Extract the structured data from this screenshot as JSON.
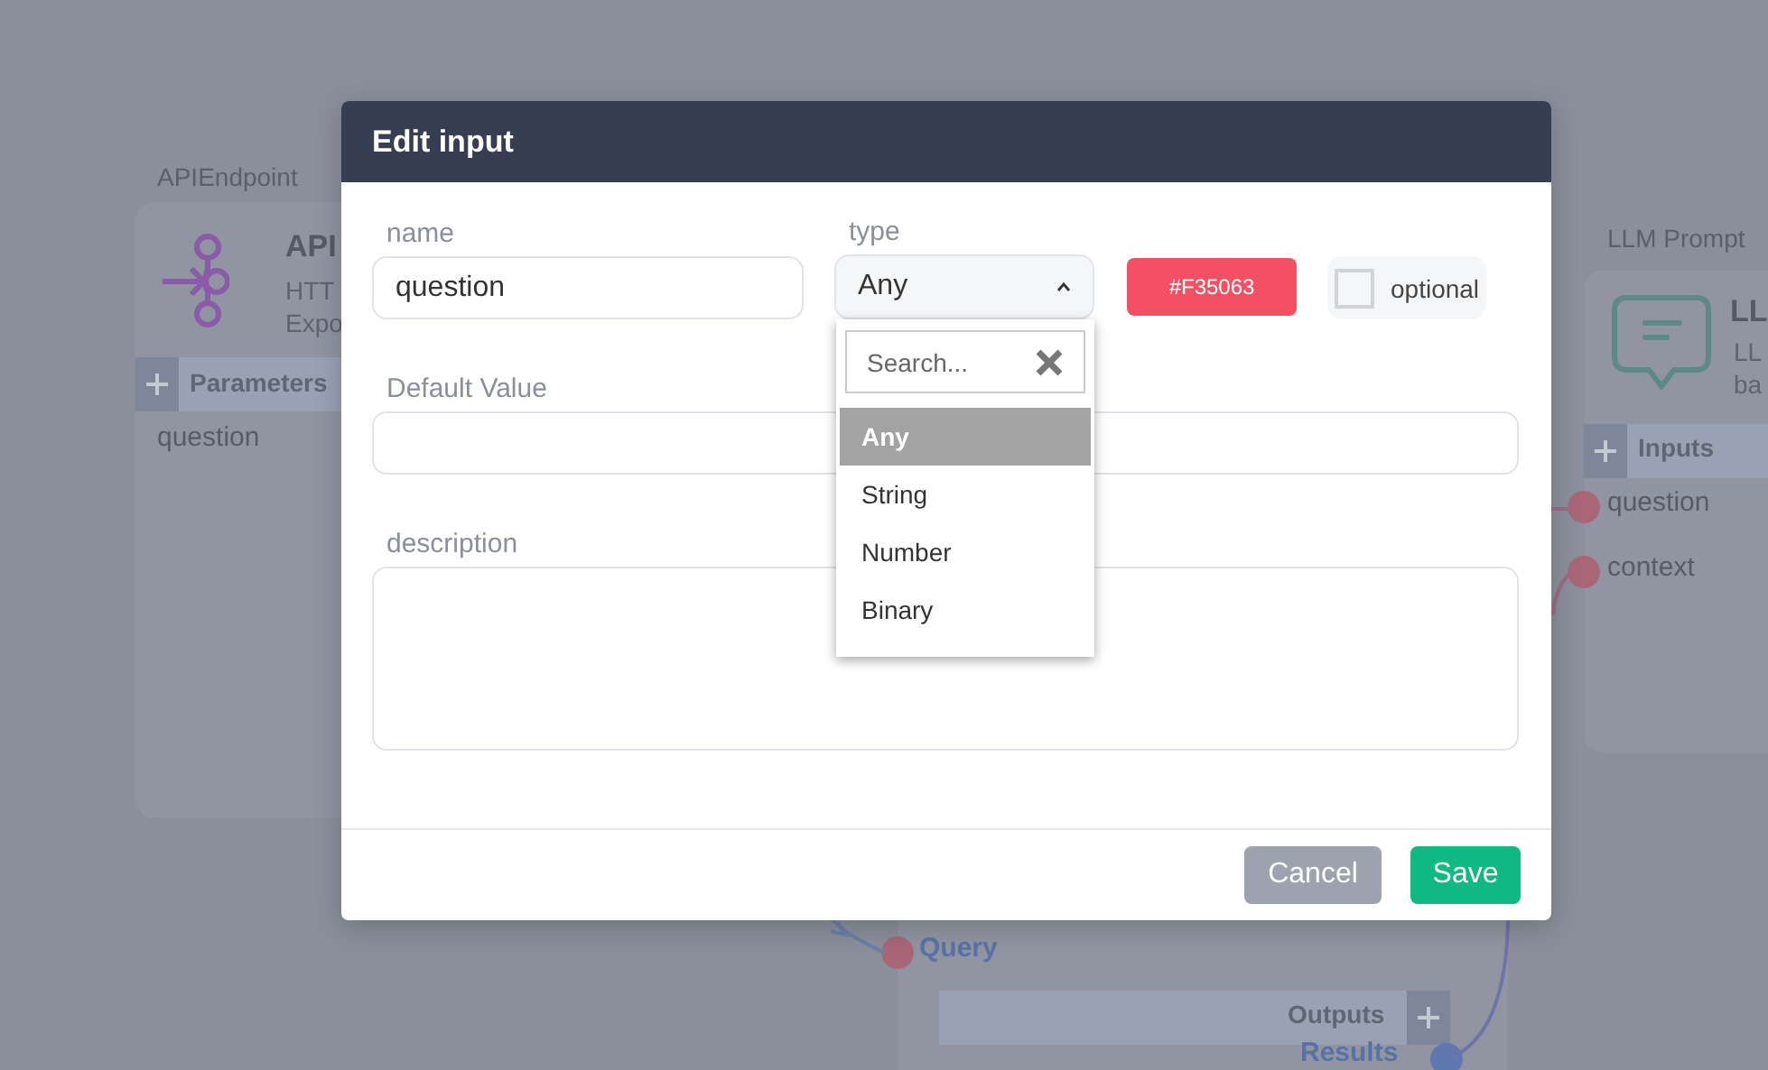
{
  "canvas": {
    "nodes": [
      {
        "kind": "endpoint",
        "label": "APIEndpoint",
        "title": "API",
        "lines": [
          "HTT",
          "Expo"
        ],
        "section": "Parameters",
        "ports": [
          {
            "name": "question"
          }
        ]
      },
      {
        "kind": "prompt",
        "label": "LLM Prompt",
        "title": "LL",
        "lines": [
          "LL",
          "ba"
        ],
        "section": "Inputs",
        "ports": [
          {
            "name": "question"
          },
          {
            "name": "context"
          }
        ]
      },
      {
        "kind": "retriever",
        "ports": [
          {
            "name": "Query"
          }
        ],
        "section": "Outputs",
        "outputs": [
          {
            "name": "Results"
          }
        ]
      }
    ]
  },
  "dialog": {
    "title": "Edit input",
    "name": {
      "label": "name",
      "value": "question"
    },
    "type": {
      "label": "type",
      "value": "Any",
      "expanded": true,
      "search_placeholder": "Search...",
      "options": [
        {
          "label": "Any",
          "selected": true
        },
        {
          "label": "String",
          "selected": false
        },
        {
          "label": "Number",
          "selected": false
        },
        {
          "label": "Binary",
          "selected": false
        }
      ]
    },
    "color_button": {
      "label": "#F35063",
      "color": "#f35063"
    },
    "optional": {
      "label": "optional",
      "checked": false
    },
    "default_value": {
      "label": "Default Value"
    },
    "description": {
      "label": "description"
    },
    "buttons": [
      {
        "label": "Cancel",
        "kind": "secondary"
      },
      {
        "label": "Save",
        "kind": "primary"
      }
    ]
  }
}
